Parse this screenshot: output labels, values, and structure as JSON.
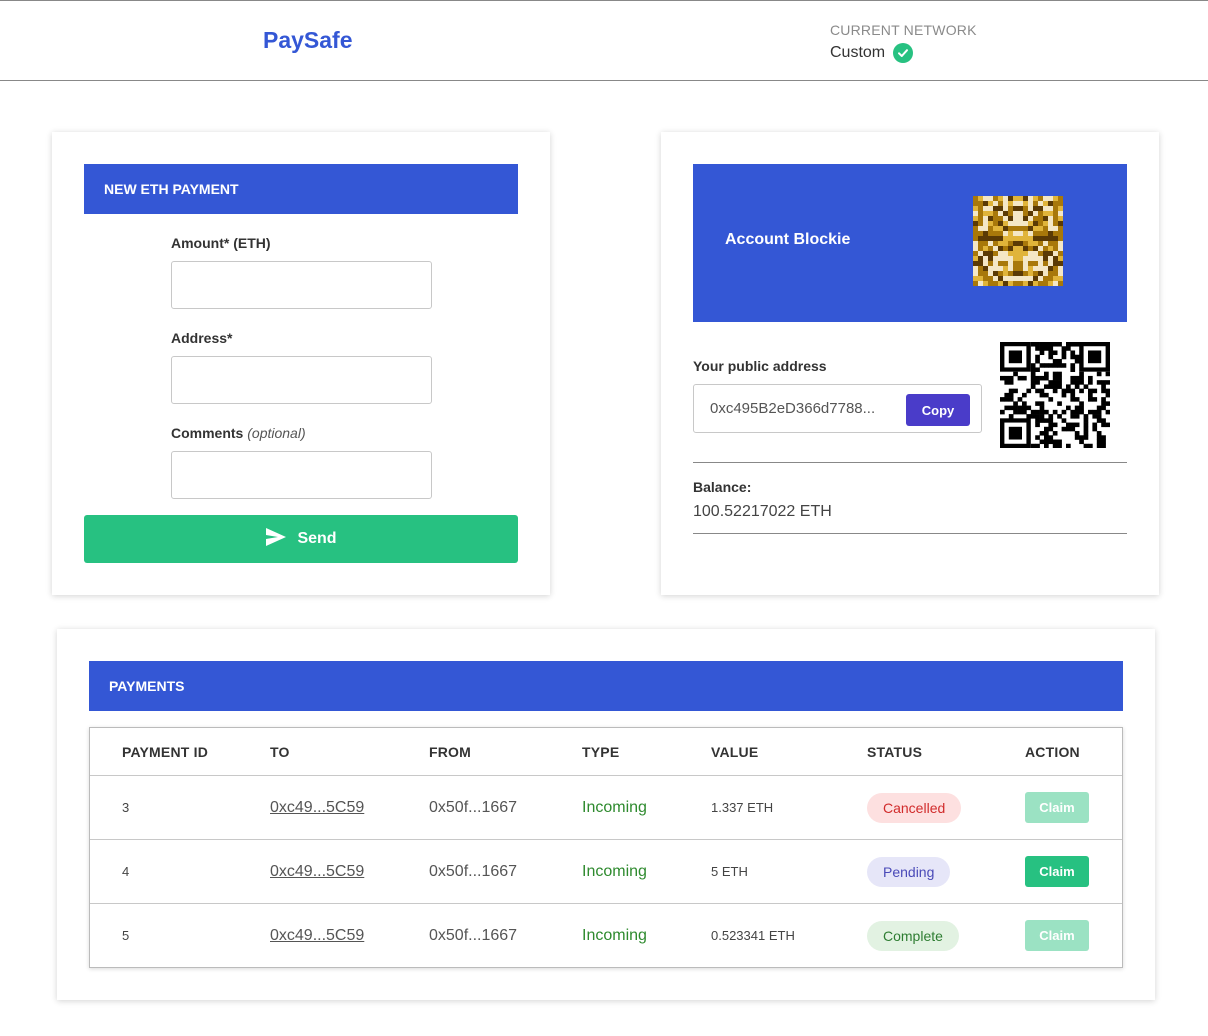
{
  "header": {
    "brand": "PaySafe",
    "network_label": "CURRENT NETWORK",
    "network_value": "Custom"
  },
  "payment_form": {
    "title": "NEW ETH PAYMENT",
    "amount_label": "Amount* (ETH)",
    "amount_value": "",
    "address_label": "Address*",
    "address_value": "",
    "comments_label": "Comments",
    "comments_hint": "(optional)",
    "comments_value": "",
    "send_label": "Send"
  },
  "account": {
    "blockie_title": "Account Blockie",
    "public_address_label": "Your public address",
    "public_address": "0xc495B2eD366d7788...",
    "copy_label": "Copy",
    "balance_label": "Balance:",
    "balance_value": "100.52217022 ETH"
  },
  "payments": {
    "title": "PAYMENTS",
    "columns": [
      "PAYMENT ID",
      "TO",
      "FROM",
      "TYPE",
      "VALUE",
      "STATUS",
      "ACTION"
    ],
    "rows": [
      {
        "id": "3",
        "to": "0xc49...5C59",
        "from": "0x50f...1667",
        "type": "Incoming",
        "value": "1.337 ETH",
        "status": "Cancelled",
        "action": "Claim",
        "action_enabled": false
      },
      {
        "id": "4",
        "to": "0xc49...5C59",
        "from": "0x50f...1667",
        "type": "Incoming",
        "value": "5 ETH",
        "status": "Pending",
        "action": "Claim",
        "action_enabled": true
      },
      {
        "id": "5",
        "to": "0xc49...5C59",
        "from": "0x50f...1667",
        "type": "Incoming",
        "value": "0.523341 ETH",
        "status": "Complete",
        "action": "Claim",
        "action_enabled": false
      }
    ]
  },
  "colors": {
    "primary": "#3457d5",
    "success": "#27c181",
    "copy_button": "#4a3cc9",
    "cancelled_bg": "#fde0e0",
    "cancelled_text": "#d12b2b",
    "pending_bg": "#e6e6f8",
    "pending_text": "#4a4ab8",
    "complete_bg": "#e2f2e2",
    "complete_text": "#2e7d32",
    "claim_disabled": "#9be2c3"
  },
  "icons": {
    "network_status": "check-circle-icon",
    "send": "send-icon"
  }
}
